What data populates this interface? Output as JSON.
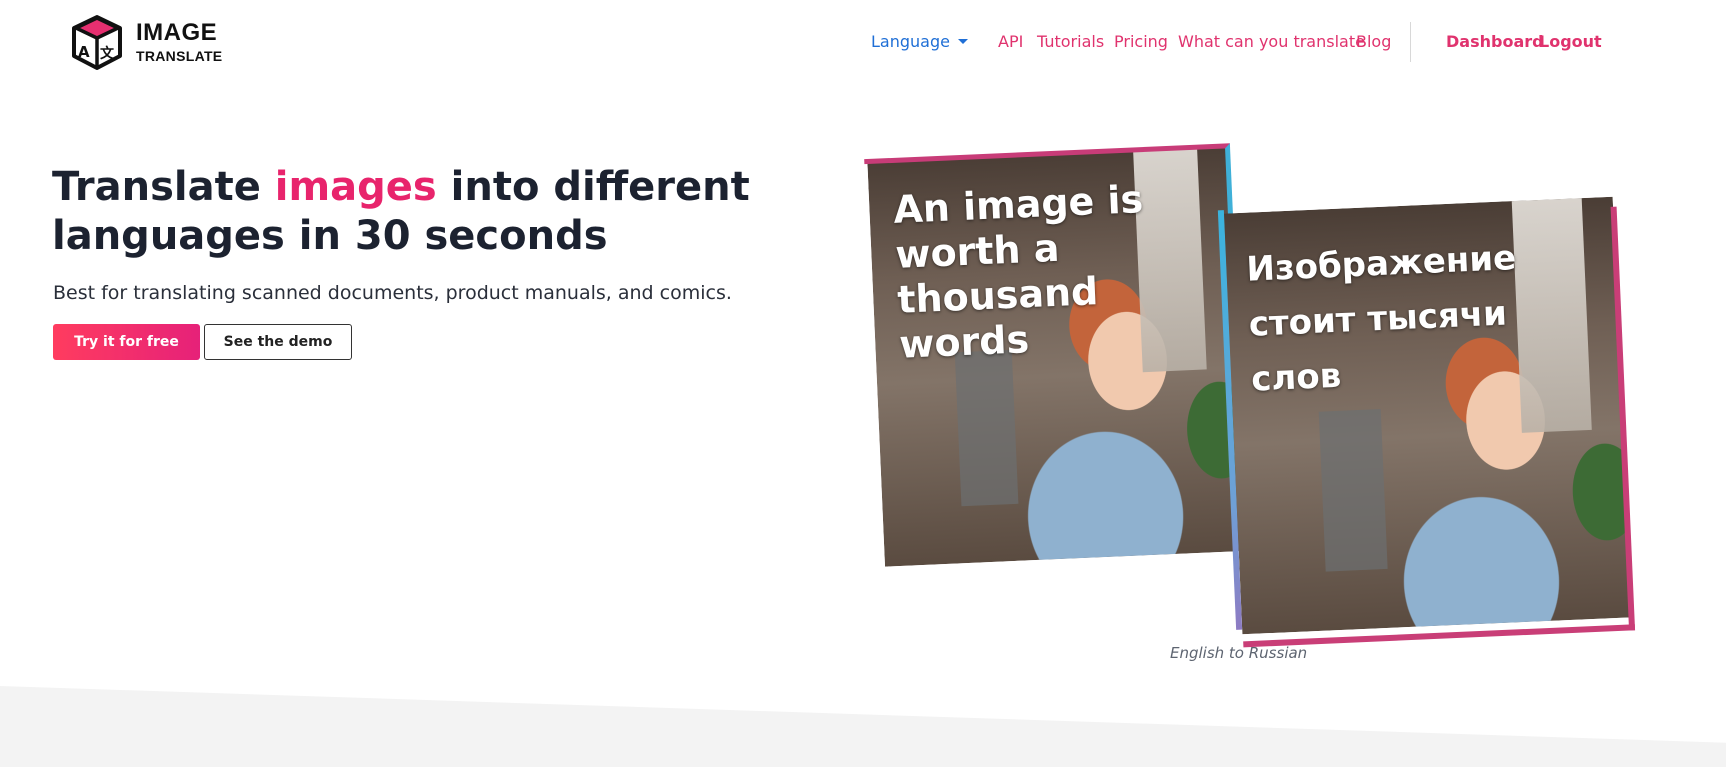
{
  "logo": {
    "line1": "IMAGE",
    "line2": "TRANSLATE",
    "icon": "dice-translate-logo"
  },
  "nav": {
    "language": "Language",
    "links": [
      "API",
      "Tutorials",
      "Pricing",
      "What can you translate",
      "Blog"
    ],
    "dashboard": "Dashboard",
    "logout": "Logout"
  },
  "hero": {
    "title_pre": "Translate ",
    "title_accent": "images",
    "title_post": " into different languages in 30 seconds",
    "subtitle": "Best for translating scanned documents, product manuals, and comics.",
    "primary_button": "Try it for free",
    "secondary_button": "See the demo"
  },
  "example": {
    "english_text": "An image is\nworth a\nthousand\nwords",
    "russian_text": "Изображение\nстоит тысячи\nслов",
    "caption": "English to Russian"
  },
  "colors": {
    "accent": "#e8246c",
    "link_blue": "#1f6fd6",
    "nav_pink": "#e0336e",
    "cyan_frame": "#3fb0d8"
  }
}
